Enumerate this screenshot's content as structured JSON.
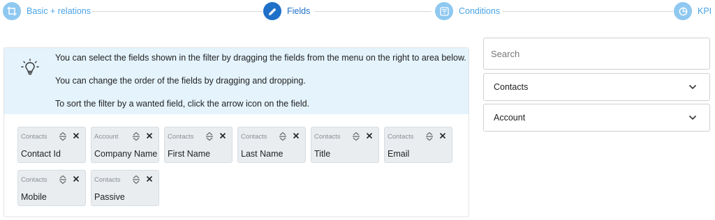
{
  "stepper": {
    "steps": [
      {
        "label": "Basic + relations",
        "icon": "crop-frame-icon",
        "state": "done"
      },
      {
        "label": "Fields",
        "icon": "pencil-icon",
        "state": "active"
      },
      {
        "label": "Conditions",
        "icon": "filter-box-icon",
        "state": "done"
      },
      {
        "label": "KPI",
        "icon": "pie-chart-icon",
        "state": "done"
      }
    ],
    "colors": {
      "active": "#1f70c8",
      "inactive": "#8fc8f0",
      "label": "#4aa3e6"
    }
  },
  "info": {
    "icon": "lightbulb-icon",
    "lines": [
      "You can select the fields shown in the filter by dragging the fields from the menu on the right to area below.",
      "You can change the order of the fields by dragging and dropping.",
      "To sort the filter by a wanted field, click the arrow icon on the field."
    ],
    "background": "#e4f3fc"
  },
  "fields": [
    {
      "source": "Contacts",
      "label": "Contact Id"
    },
    {
      "source": "Account",
      "label": "Company Name"
    },
    {
      "source": "Contacts",
      "label": "First Name"
    },
    {
      "source": "Contacts",
      "label": "Last Name"
    },
    {
      "source": "Contacts",
      "label": "Title"
    },
    {
      "source": "Contacts",
      "label": "Email"
    },
    {
      "source": "Contacts",
      "label": "Mobile"
    },
    {
      "source": "Contacts",
      "label": "Passive"
    }
  ],
  "sidebar": {
    "search": {
      "placeholder": "Search",
      "value": ""
    },
    "groups": [
      {
        "label": "Contacts"
      },
      {
        "label": "Account"
      }
    ]
  }
}
